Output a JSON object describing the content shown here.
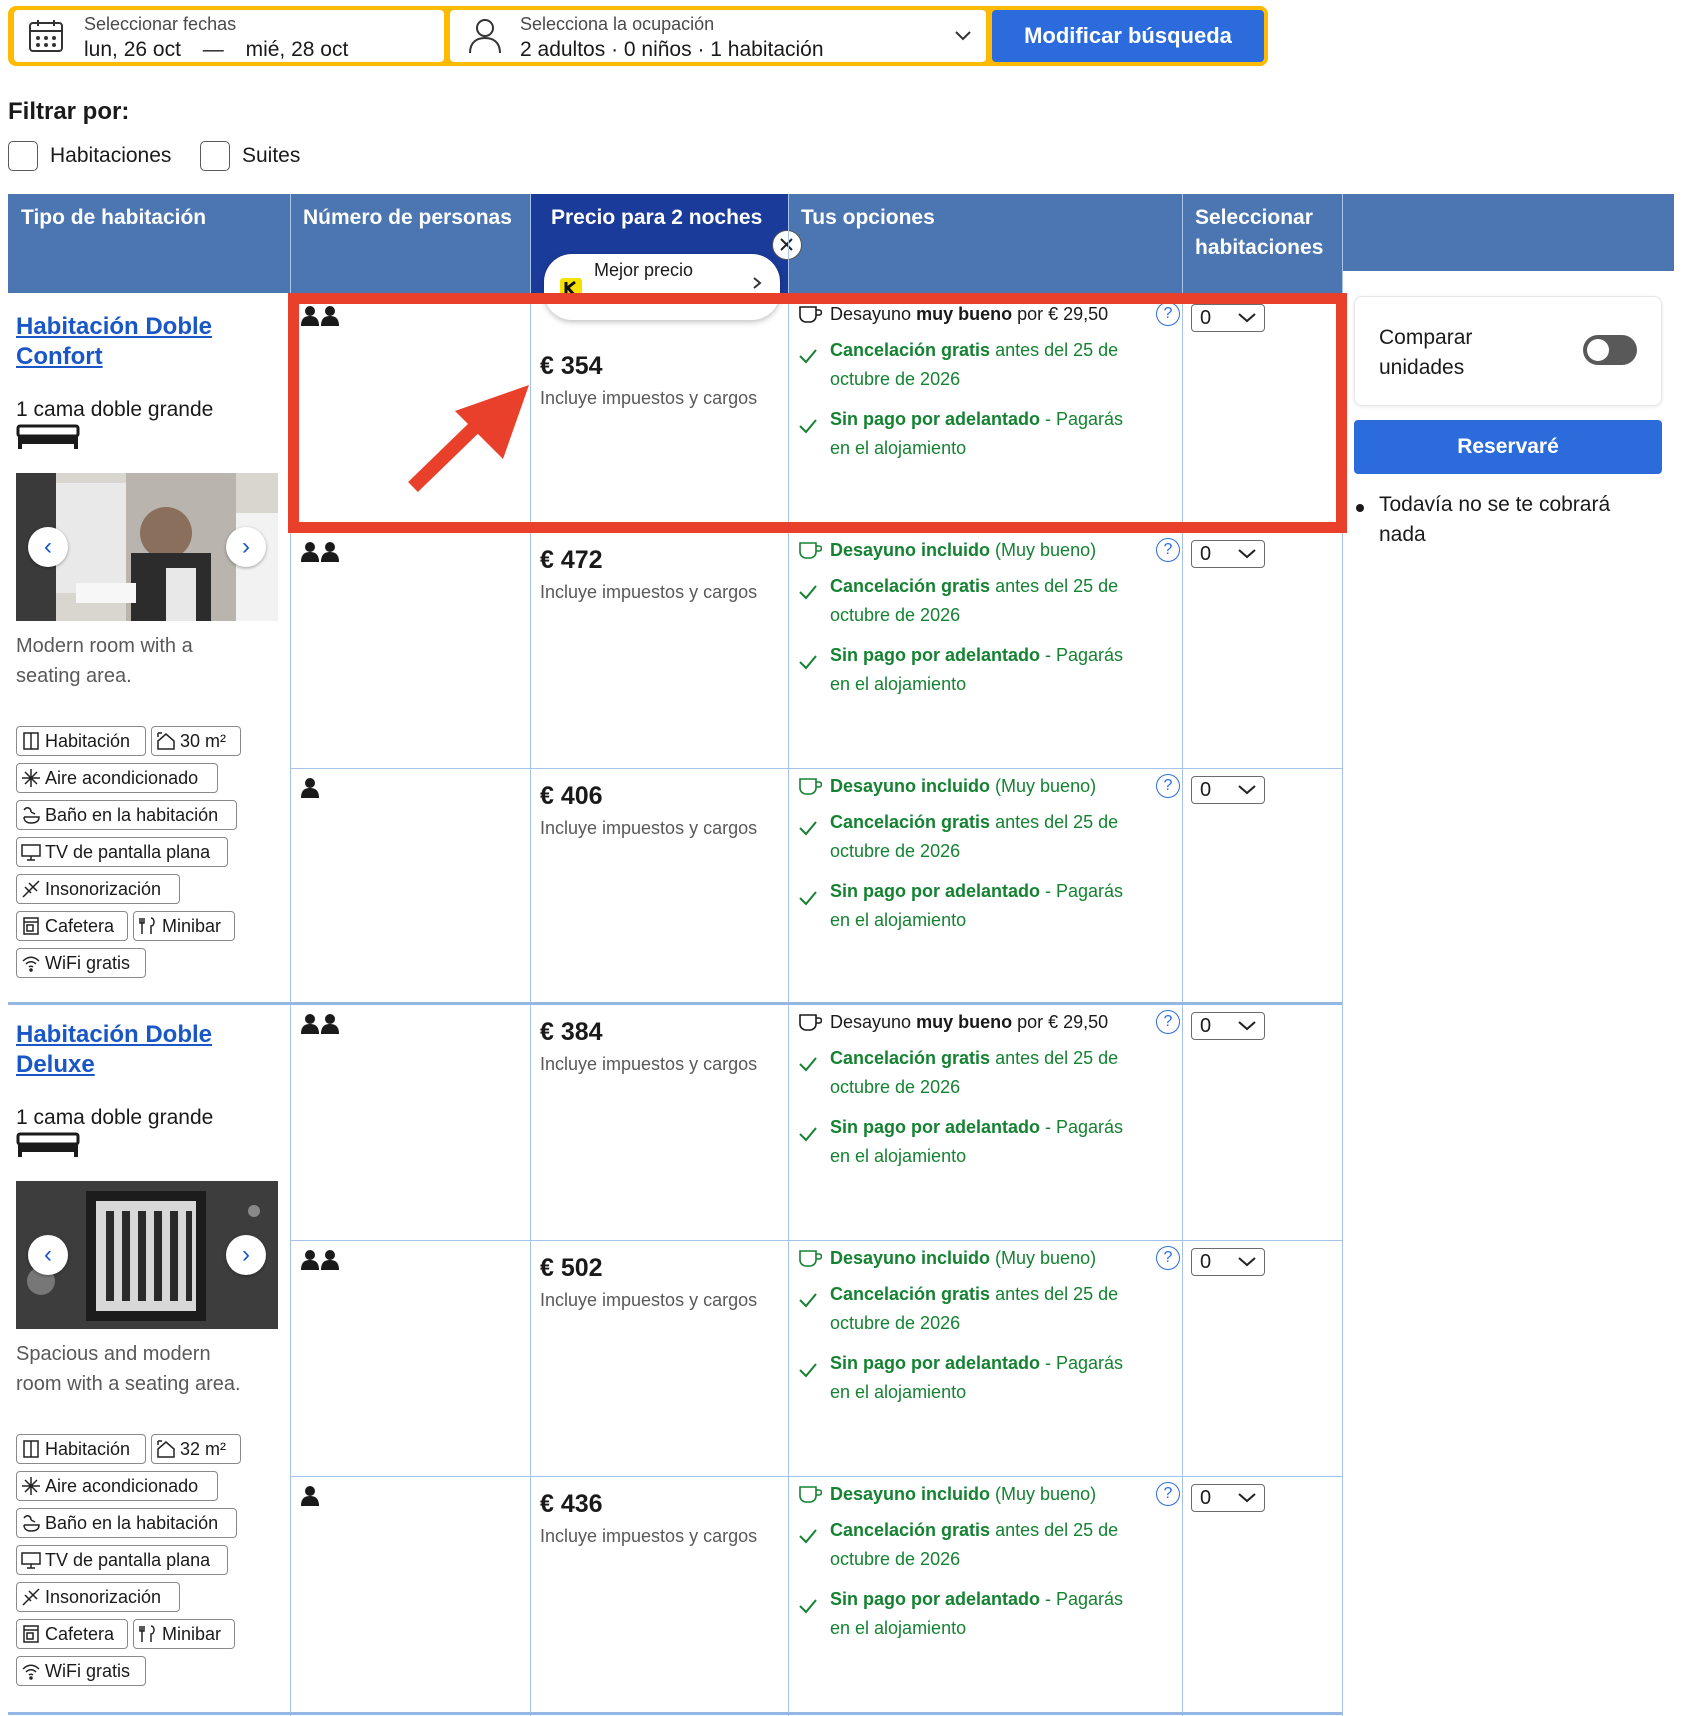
{
  "search": {
    "dates_label": "Seleccionar fechas",
    "date_from": "lun, 26 oct",
    "date_sep": "—",
    "date_to": "mié, 28 oct",
    "occupancy_label": "Selecciona la ocupación",
    "occupancy_value": "2 adultos · 0 niños · 1 habitación",
    "button": "Modificar búsqueda"
  },
  "filters": {
    "title": "Filtrar por:",
    "options": [
      "Habitaciones",
      "Suites"
    ]
  },
  "table": {
    "headers": [
      "Tipo de habitación",
      "Número de personas",
      "Precio para 2 noches",
      "Tus opciones",
      "Seleccionar habitaciones"
    ],
    "best_price_badge": "Mejor precio",
    "rooms": [
      {
        "name_line1": "Habitación Doble",
        "name_line2": "Confort",
        "bed": "1 cama doble grande",
        "desc_line1": "Modern room with a",
        "desc_line2": "seating area.",
        "facilities": [
          "Habitación",
          "30 m²",
          "Aire acondicionado",
          "Baño en la habitación",
          "TV de pantalla plana",
          "Insonorización",
          "Cafetera",
          "Minibar",
          "WiFi gratis"
        ]
      },
      {
        "name_line1": "Habitación Doble",
        "name_line2": "Deluxe",
        "bed": "1 cama doble grande",
        "desc_line1": "Spacious and modern",
        "desc_line2": "room with a seating area.",
        "facilities": [
          "Habitación",
          "32 m²",
          "Aire acondicionado",
          "Baño en la habitación",
          "TV de pantalla plana",
          "Insonorización",
          "Cafetera",
          "Minibar",
          "WiFi gratis"
        ]
      }
    ],
    "rows": [
      {
        "persons": 2,
        "price": "€ 354",
        "tax": "Incluye impuestos y cargos",
        "breakfast_type": "paid",
        "select": "0"
      },
      {
        "persons": 2,
        "price": "€ 472",
        "tax": "Incluye impuestos y cargos",
        "breakfast_type": "included",
        "select": "0"
      },
      {
        "persons": 1,
        "price": "€ 406",
        "tax": "Incluye impuestos y cargos",
        "breakfast_type": "included",
        "select": "0"
      },
      {
        "persons": 2,
        "price": "€ 384",
        "tax": "Incluye impuestos y cargos",
        "breakfast_type": "paid",
        "select": "0"
      },
      {
        "persons": 2,
        "price": "€ 502",
        "tax": "Incluye impuestos y cargos",
        "breakfast_type": "included",
        "select": "0"
      },
      {
        "persons": 1,
        "price": "€ 436",
        "tax": "Incluye impuestos y cargos",
        "breakfast_type": "included",
        "select": "0"
      }
    ],
    "options_text": {
      "paid_pre": "Desayuno ",
      "paid_bold": "muy bueno",
      "paid_post": " por € 29,50",
      "included_bold": "Desayuno incluido",
      "included_post": " (Muy bueno)",
      "cancel_bold": "Cancelación gratis",
      "cancel_rest": " antes del 25 de",
      "cancel_line2": "octubre de 2026",
      "nopay_bold": "Sin pago por adelantado",
      "nopay_rest": " - Pagarás",
      "nopay_line2": "en el alojamiento"
    }
  },
  "sidebar": {
    "compare_line1": "Comparar",
    "compare_line2": "unidades",
    "compare_toggle_on": false,
    "reserve_button": "Reservaré",
    "note_line1": "Todavía no se te cobrará",
    "note_line2": "nada"
  },
  "colors": {
    "accent": "#2b6bdc",
    "header_bg": "#4c76b2",
    "search_border": "#febb02",
    "highlight": "#e8402a",
    "success": "#158232"
  }
}
